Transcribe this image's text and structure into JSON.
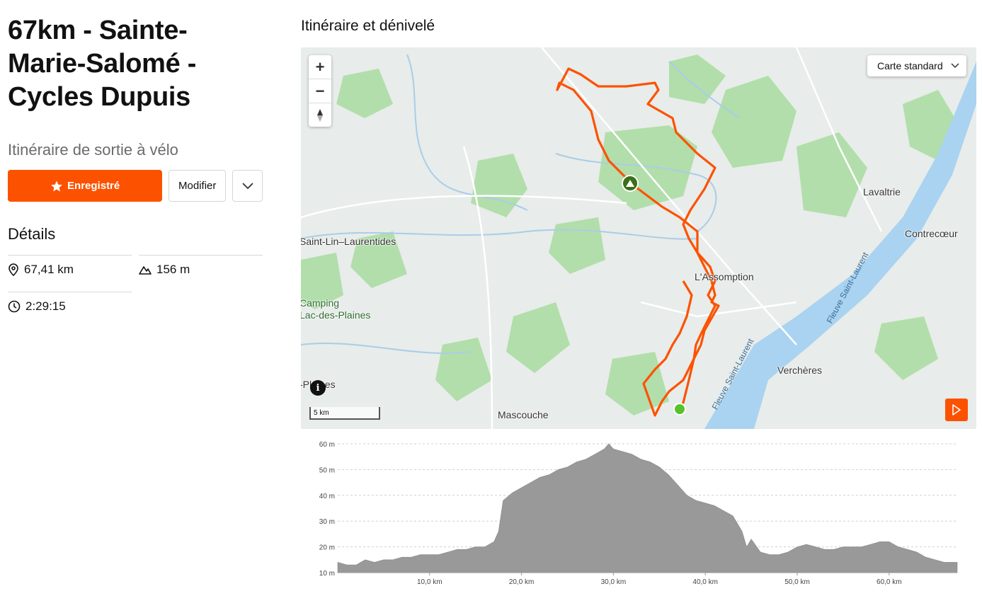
{
  "route": {
    "title": "67km - Sainte-Marie-Salomé - Cycles Dupuis",
    "subtitle": "Itinéraire de sortie à vélo"
  },
  "actions": {
    "saved_label": "Enregistré",
    "edit_label": "Modifier"
  },
  "details": {
    "title": "Détails",
    "distance": "67,41 km",
    "elevation": "156 m",
    "duration": "2:29:15"
  },
  "map_section": {
    "title": "Itinéraire et dénivelé",
    "map_style": "Carte standard",
    "scale_label": "5 km",
    "places": {
      "saint_lin": "Saint-Lin–Laurentides",
      "camping": "Camping",
      "lac_des_plaines": "Lac-des-Plaines",
      "plaines": "-Plaines",
      "mascouche": "Mascouche",
      "lassomption": "L'Assomption",
      "lavaltrie": "Lavaltrie",
      "contrecoeur": "Contrecœur",
      "vercheres": "Verchères",
      "fleuve": "Fleuve Saint-Laurent"
    }
  },
  "chart_data": {
    "type": "area",
    "title": "",
    "xlabel": "",
    "ylabel": "",
    "x_unit": "km",
    "y_unit": "m",
    "xlim": [
      0,
      67.41
    ],
    "ylim": [
      10,
      60
    ],
    "x_ticks": [
      "10,0 km",
      "20,0 km",
      "30,0 km",
      "40,0 km",
      "50,0 km",
      "60,0 km"
    ],
    "y_ticks": [
      "10 m",
      "20 m",
      "30 m",
      "40 m",
      "50 m",
      "60 m"
    ],
    "x_tick_values": [
      10,
      20,
      30,
      40,
      50,
      60
    ],
    "y_tick_values": [
      10,
      20,
      30,
      40,
      50,
      60
    ],
    "grid": true,
    "color": "#999999",
    "series": [
      {
        "x": [
          0,
          1,
          2,
          3,
          4,
          5,
          6,
          7,
          8,
          9,
          10,
          11,
          12,
          13,
          14,
          15,
          16,
          17,
          17.5,
          18,
          19,
          20,
          21,
          22,
          23,
          24,
          25,
          26,
          27,
          28,
          29,
          29.5,
          30,
          31,
          32,
          33,
          34,
          35,
          36,
          37,
          38,
          39,
          40,
          41,
          42,
          43,
          44,
          44.5,
          45,
          46,
          47,
          48,
          49,
          50,
          51,
          52,
          53,
          54,
          55,
          56,
          57,
          58,
          59,
          60,
          61,
          62,
          63,
          64,
          65,
          66,
          67.41
        ],
        "y": [
          14,
          13,
          13,
          15,
          14,
          15,
          15,
          16,
          16,
          17,
          17,
          17,
          18,
          19,
          19,
          20,
          20,
          22,
          26,
          38,
          41,
          43,
          45,
          47,
          48,
          50,
          51,
          53,
          54,
          56,
          58,
          60,
          58,
          57,
          56,
          54,
          53,
          51,
          48,
          44,
          40,
          38,
          37,
          36,
          34,
          32,
          26,
          20,
          23,
          18,
          17,
          17,
          18,
          20,
          21,
          20,
          19,
          19,
          20,
          20,
          20,
          21,
          22,
          22,
          20,
          19,
          18,
          16,
          15,
          14,
          14
        ]
      }
    ]
  }
}
